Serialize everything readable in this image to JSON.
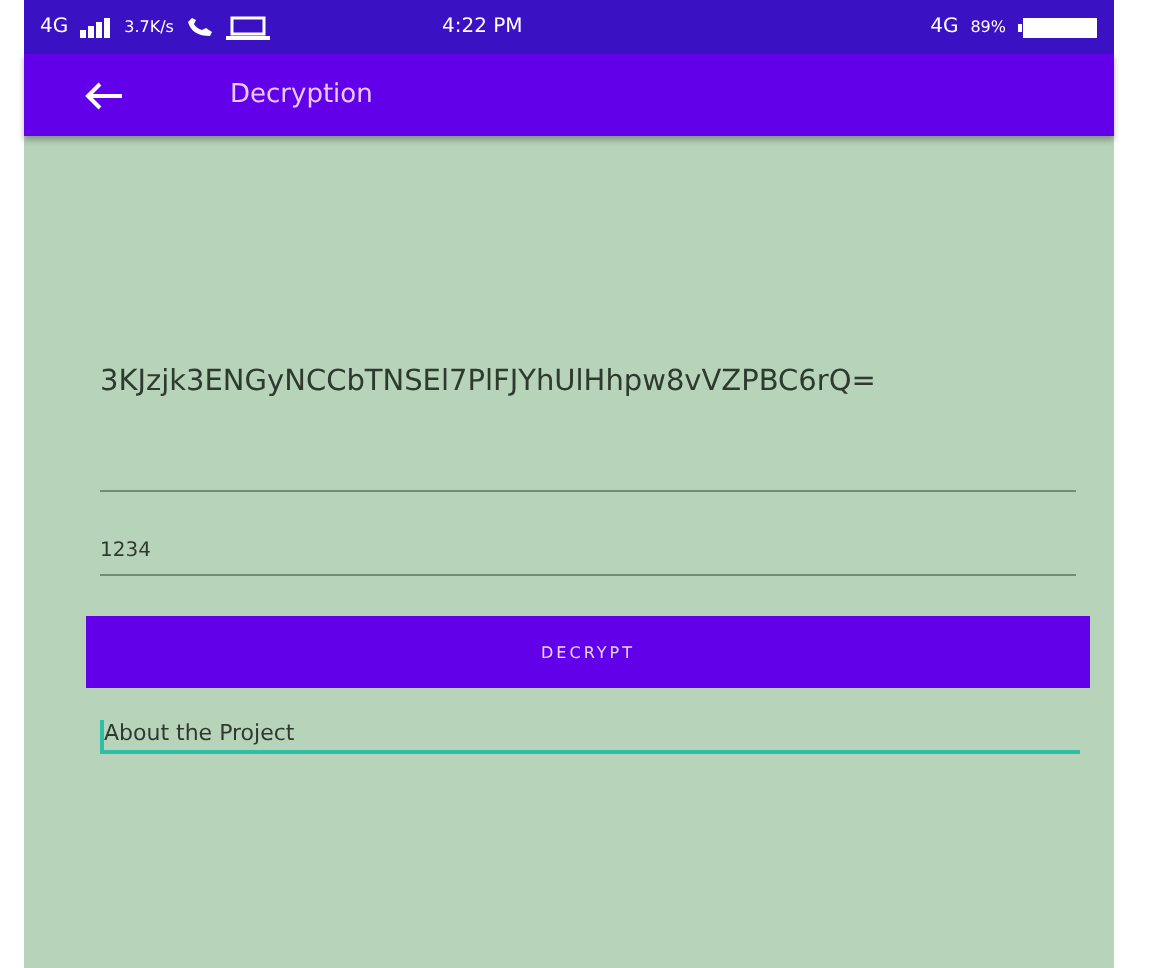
{
  "status_bar": {
    "network": "4G",
    "speed": "3.7K/s",
    "time": "4:22 PM",
    "network_right": "4G",
    "battery": "89%"
  },
  "app_bar": {
    "title": "Decryption"
  },
  "cipher_text": "3KJzjk3ENGyNCCbTNSEl7PlFJYhUlHhpw8vVZPBC6rQ=",
  "key_field": {
    "value": "1234",
    "focused": false
  },
  "button": "DECRYPT",
  "about_field": {
    "value": "About the Project",
    "focused": true
  }
}
